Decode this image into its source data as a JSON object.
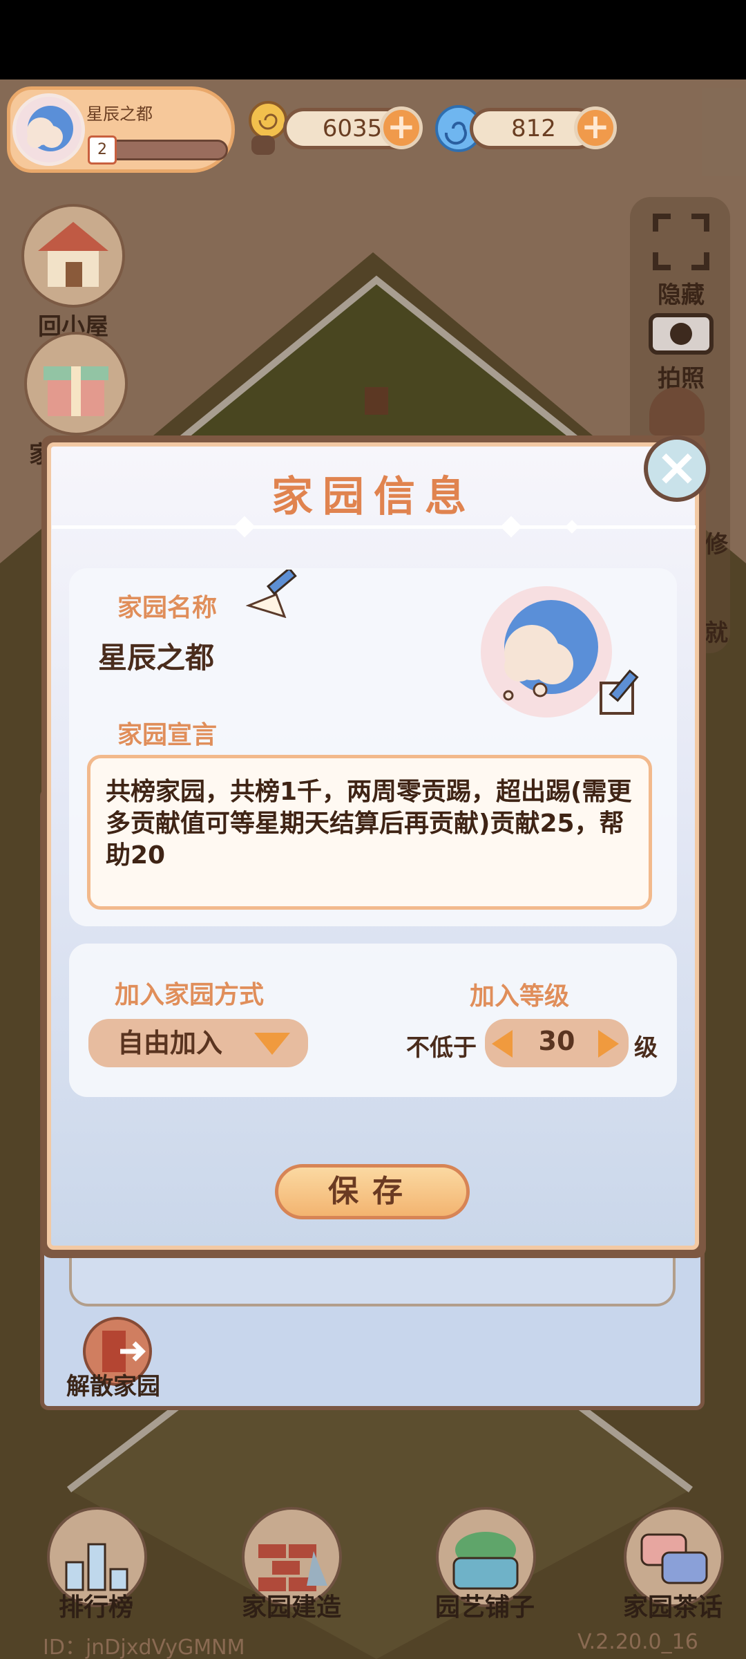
{
  "hud": {
    "home_name": "星辰之都",
    "level": "2",
    "coins": "6035",
    "gems": "812"
  },
  "side_left": {
    "back_home": "回小屋",
    "welfare": "家园福利"
  },
  "side_right": {
    "hide": "隐藏",
    "photo": "拍照",
    "decorate": "修",
    "achievement": "就"
  },
  "modal": {
    "title": "家园信息",
    "name_label": "家园名称",
    "name_value": "星辰之都",
    "manifesto_label": "家园宣言",
    "manifesto_text": "共榜家园，共榜1千，两周零贡踢，超出踢(需更多贡献值可等星期天结算后再贡献)贡献25，帮助20",
    "join_label": "加入家园方式",
    "join_value": "自由加入",
    "level_label": "加入等级",
    "level_prefix": "不低于",
    "level_value": "30",
    "level_suffix": "级",
    "save": "保存"
  },
  "back_panel": {
    "dissolve": "解散家园"
  },
  "bottom_nav": [
    {
      "label": "排行榜"
    },
    {
      "label": "家园建造"
    },
    {
      "label": "园艺铺子"
    },
    {
      "label": "家园茶话"
    }
  ],
  "footer": {
    "id": "ID：jnDjxdVyGMNM",
    "version": "V.2.20.0_16"
  },
  "colors": {
    "title_orange": "#e0834f",
    "button_orange": "#f09a3e",
    "panel_border": "#7d5842"
  }
}
